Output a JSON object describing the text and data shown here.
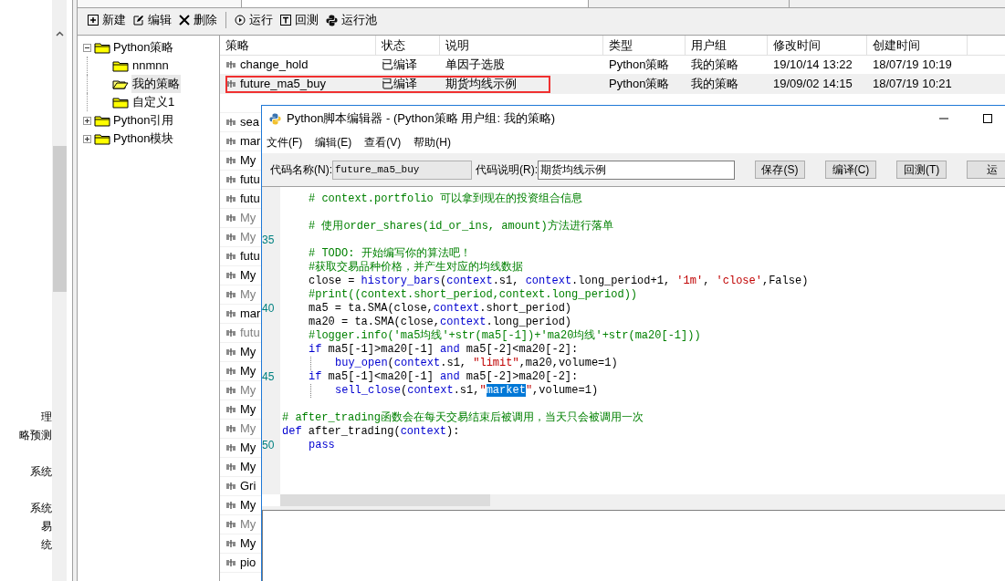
{
  "sidebar": {
    "groups": [
      [
        "理",
        "略预测"
      ],
      [
        "系统"
      ],
      [
        "系统",
        "易",
        "统"
      ]
    ]
  },
  "toolbar": [
    {
      "kind": "new",
      "label": "新建"
    },
    {
      "kind": "edit",
      "label": "编辑"
    },
    {
      "kind": "delete",
      "label": "删除"
    },
    {
      "kind": "run",
      "label": "运行"
    },
    {
      "kind": "backtest",
      "label": "回测"
    },
    {
      "kind": "pool",
      "label": "运行池"
    }
  ],
  "tree": [
    {
      "label": "Python策略",
      "expanded": true,
      "children": [
        {
          "label": "nnmnn",
          "selected": false
        },
        {
          "label": "我的策略",
          "selected": true
        },
        {
          "label": "自定义1",
          "selected": false
        }
      ]
    },
    {
      "label": "Python引用",
      "expanded": false
    },
    {
      "label": "Python模块",
      "expanded": false
    }
  ],
  "table": {
    "columns": [
      "策略",
      "状态",
      "说明",
      "类型",
      "用户组",
      "修改时间",
      "创建时间"
    ],
    "rows": [
      {
        "cells": [
          "change_hold",
          "已编译",
          "单因子选股",
          "Python策略",
          "我的策略",
          "19/10/14 13:22",
          "18/07/19 10:19"
        ],
        "selected": false,
        "outlined": false,
        "dimmed": false
      },
      {
        "cells": [
          "future_ma5_buy",
          "已编译",
          "期货均线示例",
          "Python策略",
          "我的策略",
          "19/09/02 14:15",
          "18/07/19 10:21"
        ],
        "selected": true,
        "outlined": true,
        "dimmed": false
      },
      {
        "cells": [
          "sea"
        ],
        "selected": false,
        "outlined": false,
        "dimmed": false
      },
      {
        "cells": [
          "mar"
        ],
        "selected": false,
        "outlined": false,
        "dimmed": false
      },
      {
        "cells": [
          "My"
        ],
        "selected": false,
        "outlined": false,
        "dimmed": false
      },
      {
        "cells": [
          "futu"
        ],
        "selected": false,
        "outlined": false,
        "dimmed": false
      },
      {
        "cells": [
          "futu"
        ],
        "selected": false,
        "outlined": false,
        "dimmed": false
      },
      {
        "cells": [
          "My"
        ],
        "selected": false,
        "outlined": false,
        "dimmed": true
      },
      {
        "cells": [
          "My"
        ],
        "selected": false,
        "outlined": false,
        "dimmed": true
      },
      {
        "cells": [
          "futu"
        ],
        "selected": false,
        "outlined": false,
        "dimmed": false
      },
      {
        "cells": [
          "My"
        ],
        "selected": false,
        "outlined": false,
        "dimmed": false
      },
      {
        "cells": [
          "My"
        ],
        "selected": false,
        "outlined": false,
        "dimmed": true
      },
      {
        "cells": [
          "mar"
        ],
        "selected": false,
        "outlined": false,
        "dimmed": false
      },
      {
        "cells": [
          "futu"
        ],
        "selected": false,
        "outlined": false,
        "dimmed": true
      },
      {
        "cells": [
          "My"
        ],
        "selected": false,
        "outlined": false,
        "dimmed": false
      },
      {
        "cells": [
          "My"
        ],
        "selected": false,
        "outlined": false,
        "dimmed": false
      },
      {
        "cells": [
          "My"
        ],
        "selected": false,
        "outlined": false,
        "dimmed": true
      },
      {
        "cells": [
          "My"
        ],
        "selected": false,
        "outlined": false,
        "dimmed": false
      },
      {
        "cells": [
          "My"
        ],
        "selected": false,
        "outlined": false,
        "dimmed": true
      },
      {
        "cells": [
          "My"
        ],
        "selected": false,
        "outlined": false,
        "dimmed": false
      },
      {
        "cells": [
          "My"
        ],
        "selected": false,
        "outlined": false,
        "dimmed": false
      },
      {
        "cells": [
          "Gri"
        ],
        "selected": false,
        "outlined": false,
        "dimmed": false
      },
      {
        "cells": [
          "My"
        ],
        "selected": false,
        "outlined": false,
        "dimmed": false
      },
      {
        "cells": [
          "My"
        ],
        "selected": false,
        "outlined": false,
        "dimmed": true
      },
      {
        "cells": [
          "My"
        ],
        "selected": false,
        "outlined": false,
        "dimmed": false
      },
      {
        "cells": [
          "pio"
        ],
        "selected": false,
        "outlined": false,
        "dimmed": false
      }
    ]
  },
  "editor": {
    "title": "Python脚本编辑器 - (Python策略 用户组: 我的策略)",
    "menu": [
      "文件(F)",
      "编辑(E)",
      "查看(V)",
      "帮助(H)"
    ],
    "name_label": "代码名称(N):",
    "name_value": "future_ma5_buy",
    "desc_label": "代码说明(R):",
    "desc_value": "期货均线示例",
    "buttons": [
      "保存(S)",
      "编译(C)",
      "回测(T)",
      "运"
    ],
    "lines": [
      {
        "kind": "body",
        "tokens": [
          {
            "kind": "comment",
            "text": "# context.portfolio 可以拿到现在的投资组合信息"
          }
        ]
      },
      {
        "kind": "blank"
      },
      {
        "kind": "body",
        "tokens": [
          {
            "kind": "comment",
            "text": "# 使用order_shares(id_or_ins, amount)方法进行落单"
          }
        ]
      },
      {
        "number": "35",
        "kind": "blank"
      },
      {
        "kind": "body",
        "tokens": [
          {
            "kind": "comment",
            "text": "# TODO: 开始编写你的算法吧！"
          }
        ]
      },
      {
        "kind": "body",
        "tokens": [
          {
            "kind": "comment",
            "text": "#获取交易品种价格，并产生对应的均线数据"
          }
        ]
      },
      {
        "kind": "body",
        "tokens": [
          {
            "kind": "plain",
            "text": "close = "
          },
          {
            "kind": "keyword",
            "text": "history_bars"
          },
          {
            "kind": "plain",
            "text": "("
          },
          {
            "kind": "keyword",
            "text": "context"
          },
          {
            "kind": "plain",
            "text": ".s1, "
          },
          {
            "kind": "keyword",
            "text": "context"
          },
          {
            "kind": "plain",
            "text": ".long_period+1, "
          },
          {
            "kind": "string",
            "text": "'1m'"
          },
          {
            "kind": "plain",
            "text": ", "
          },
          {
            "kind": "string",
            "text": "'close'"
          },
          {
            "kind": "plain",
            "text": ",False)"
          }
        ]
      },
      {
        "kind": "body",
        "tokens": [
          {
            "kind": "comment",
            "text": "#print((context.short_period,context.long_period))"
          }
        ]
      },
      {
        "number": "40",
        "kind": "body",
        "tokens": [
          {
            "kind": "plain",
            "text": "ma5 = ta.SMA(close,"
          },
          {
            "kind": "keyword",
            "text": "context"
          },
          {
            "kind": "plain",
            "text": ".short_period)"
          }
        ]
      },
      {
        "kind": "body",
        "tokens": [
          {
            "kind": "plain",
            "text": "ma20 = ta.SMA(close,"
          },
          {
            "kind": "keyword",
            "text": "context"
          },
          {
            "kind": "plain",
            "text": ".long_period)"
          }
        ]
      },
      {
        "kind": "body",
        "tokens": [
          {
            "kind": "comment",
            "text": "#logger.info('ma5均线'+str(ma5[-1])+'ma20均线'+str(ma20[-1]))"
          }
        ]
      },
      {
        "kind": "body",
        "tokens": [
          {
            "kind": "keyword",
            "text": "if"
          },
          {
            "kind": "plain",
            "text": " ma5[-1]>ma20[-1] "
          },
          {
            "kind": "keyword",
            "text": "and"
          },
          {
            "kind": "plain",
            "text": " ma5[-2]<ma20[-2]:"
          }
        ]
      },
      {
        "kind": "nested",
        "tokens": [
          {
            "kind": "keyword",
            "text": "buy_open"
          },
          {
            "kind": "plain",
            "text": "("
          },
          {
            "kind": "keyword",
            "text": "context"
          },
          {
            "kind": "plain",
            "text": ".s1, "
          },
          {
            "kind": "string",
            "text": "\"limit\""
          },
          {
            "kind": "plain",
            "text": ",ma20,volume=1)"
          }
        ]
      },
      {
        "number": "45",
        "kind": "body",
        "tokens": [
          {
            "kind": "keyword",
            "text": "if"
          },
          {
            "kind": "plain",
            "text": " ma5[-1]<ma20[-1] "
          },
          {
            "kind": "keyword",
            "text": "and"
          },
          {
            "kind": "plain",
            "text": " ma5[-2]>ma20[-2]:"
          }
        ]
      },
      {
        "kind": "nested",
        "tokens": [
          {
            "kind": "keyword",
            "text": "sell_close"
          },
          {
            "kind": "plain",
            "text": "("
          },
          {
            "kind": "keyword",
            "text": "context"
          },
          {
            "kind": "plain",
            "text": ".s1,"
          },
          {
            "kind": "string",
            "text": "\""
          },
          {
            "kind": "selected",
            "text": "market"
          },
          {
            "kind": "string",
            "text": "\""
          },
          {
            "kind": "plain",
            "text": ",volume=1)"
          }
        ]
      },
      {
        "kind": "blank"
      },
      {
        "kind": "top",
        "tokens": [
          {
            "kind": "comment",
            "text": "# after_trading函数会在每天交易结束后被调用，当天只会被调用一次"
          }
        ]
      },
      {
        "kind": "top",
        "tokens": [
          {
            "kind": "keyword",
            "text": "def"
          },
          {
            "kind": "plain",
            "text": " after_trading("
          },
          {
            "kind": "keyword",
            "text": "context"
          },
          {
            "kind": "plain",
            "text": "):"
          }
        ]
      },
      {
        "number": "50",
        "kind": "body",
        "tokens": [
          {
            "kind": "keyword",
            "text": "pass"
          }
        ]
      }
    ]
  }
}
